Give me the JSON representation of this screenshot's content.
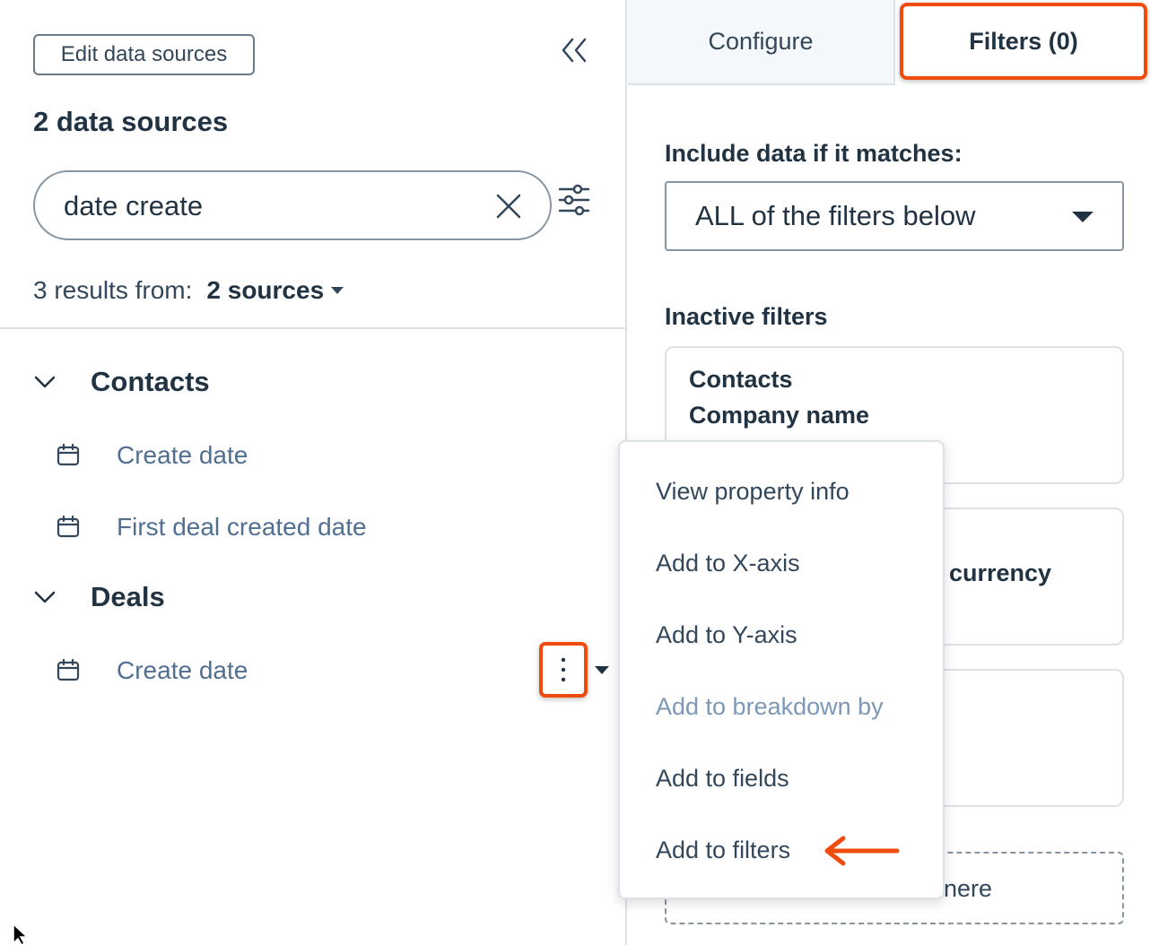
{
  "left": {
    "edit_button": "Edit data sources",
    "sources_title": "2 data sources",
    "search_value": "date create",
    "results_prefix": "3 results from:",
    "results_sources": "2 sources",
    "groups": [
      {
        "name": "Contacts",
        "items": [
          "Create date",
          "First deal created date"
        ]
      },
      {
        "name": "Deals",
        "items": [
          "Create date"
        ]
      }
    ]
  },
  "right": {
    "tabs": {
      "configure": "Configure",
      "filters": "Filters (0)"
    },
    "include_label": "Include data if it matches:",
    "match_value": "ALL of the filters below",
    "inactive_label": "Inactive filters",
    "card1": {
      "line1": "Contacts",
      "line2": "Company name"
    },
    "card2_partial": "currency",
    "drop_partial": "nere"
  },
  "menu": {
    "items": [
      {
        "label": "View property info",
        "disabled": false
      },
      {
        "label": "Add to X-axis",
        "disabled": false
      },
      {
        "label": "Add to Y-axis",
        "disabled": false
      },
      {
        "label": "Add to breakdown by",
        "disabled": true
      },
      {
        "label": "Add to fields",
        "disabled": false
      },
      {
        "label": "Add to filters",
        "disabled": false
      }
    ]
  },
  "colors": {
    "highlight": "#f04c0f",
    "text_dark": "#213343",
    "text_muted": "#516f90"
  }
}
